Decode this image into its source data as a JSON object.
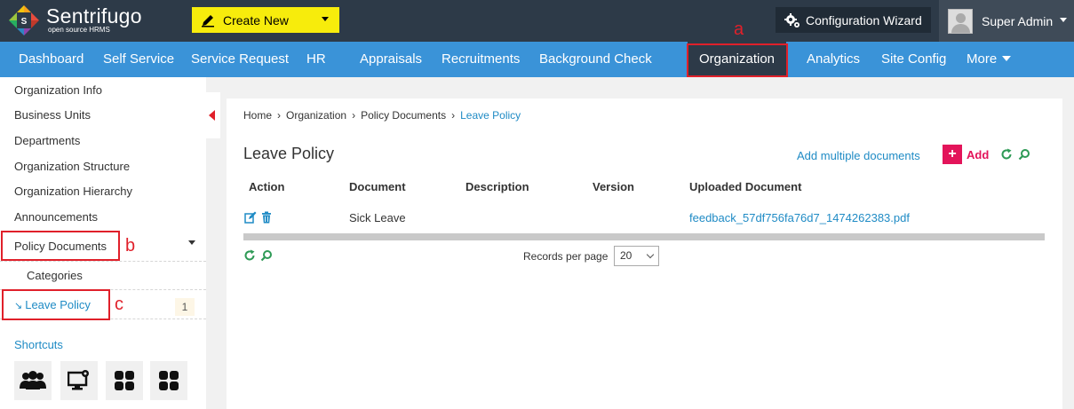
{
  "app": {
    "name": "Sentrifugo",
    "tagline": "open source HRMS"
  },
  "topbar": {
    "create_new": "Create New",
    "config_wizard": "Configuration Wizard",
    "user_name": "Super Admin"
  },
  "nav": {
    "items": [
      "Dashboard",
      "Self Service",
      "Service Request",
      "HR",
      "Appraisals",
      "Recruitments",
      "Background Check",
      "Organization",
      "Analytics",
      "Site Config",
      "More"
    ],
    "active": "Organization"
  },
  "annotations": [
    "a",
    "b",
    "c"
  ],
  "sidebar": {
    "items": [
      "Organization Info",
      "Business Units",
      "Departments",
      "Organization Structure",
      "Organization Hierarchy",
      "Announcements",
      "Policy Documents"
    ],
    "sub_items": [
      "Categories"
    ],
    "active_link": "Leave Policy",
    "active_count": "1",
    "shortcuts_label": "Shortcuts",
    "shortcut_icons": [
      "people-icon",
      "desktop-gear-icon",
      "grid-icon",
      "grid-icon"
    ]
  },
  "breadcrumb": {
    "items": [
      "Home",
      "Organization",
      "Policy Documents"
    ],
    "current": "Leave Policy"
  },
  "page": {
    "title": "Leave Policy",
    "add_multiple": "Add multiple documents",
    "add": "Add"
  },
  "table": {
    "headers": [
      "Action",
      "Document",
      "Description",
      "Version",
      "Uploaded Document"
    ],
    "rows": [
      {
        "document": "Sick Leave",
        "description": "",
        "version": "",
        "uploaded": "feedback_57df756fa76d7_1474262383.pdf"
      }
    ]
  },
  "pagination": {
    "label": "Records per page",
    "value": "20"
  },
  "colors": {
    "topbar": "#2d3a48",
    "navbar": "#3a93d8",
    "create_new": "#f7ec0c",
    "link": "#1f8bc5",
    "accent_add": "#e3145a",
    "annotation": "#e0202a",
    "icon_green": "#2e9a56"
  }
}
